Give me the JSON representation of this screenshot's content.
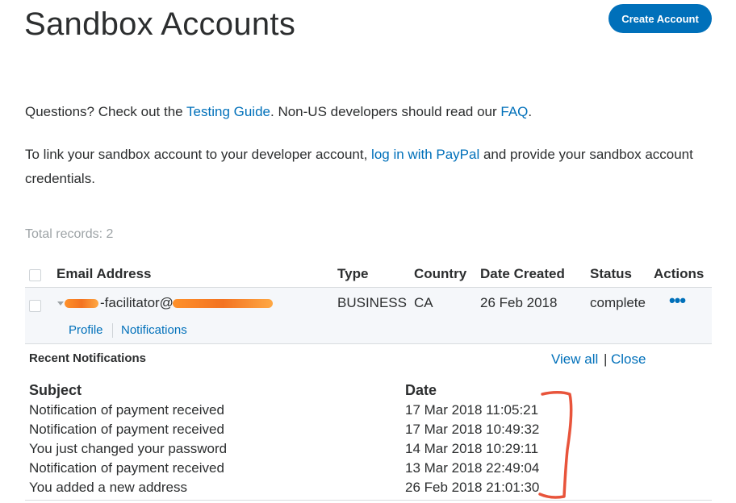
{
  "header": {
    "title": "Sandbox Accounts",
    "create_button": "Create Account"
  },
  "intro": {
    "questions_prefix": "Questions? Check out the ",
    "testing_guide_link": "Testing Guide",
    "questions_middle": ". Non-US developers should read our ",
    "faq_link": "FAQ",
    "questions_suffix": ".",
    "link_prefix": "To link your sandbox account to your developer account, ",
    "login_link": "log in with PayPal",
    "link_suffix": " and provide your sandbox account credentials."
  },
  "total_records": "Total records: 2",
  "table": {
    "columns": [
      "Email Address",
      "Type",
      "Country",
      "Date Created",
      "Status",
      "Actions"
    ],
    "row": {
      "email_visible": "-facilitator@",
      "type": "BUSINESS",
      "country": "CA",
      "date_created": "26 Feb 2018",
      "status": "complete",
      "actions_icon": "more-dots-icon",
      "profile_link": "Profile",
      "notifications_link": "Notifications"
    }
  },
  "notifications": {
    "title": "Recent Notifications",
    "view_all": "View all",
    "separator": "|",
    "close": "Close",
    "subject_header": "Subject",
    "date_header": "Date",
    "items": [
      {
        "subject": "Notification of payment received",
        "date": "17 Mar 2018 11:05:21"
      },
      {
        "subject": "Notification of payment received",
        "date": "17 Mar 2018 10:49:32"
      },
      {
        "subject": "You just changed your password",
        "date": "14 Mar 2018 10:29:11"
      },
      {
        "subject": "Notification of payment received",
        "date": "13 Mar 2018 22:49:04"
      },
      {
        "subject": "You added a new address",
        "date": "26 Feb 2018 21:01:30"
      }
    ]
  },
  "colors": {
    "brand_blue": "#0070ba",
    "redaction_orange": "#f36c16",
    "annotation_red": "#e8543b"
  }
}
